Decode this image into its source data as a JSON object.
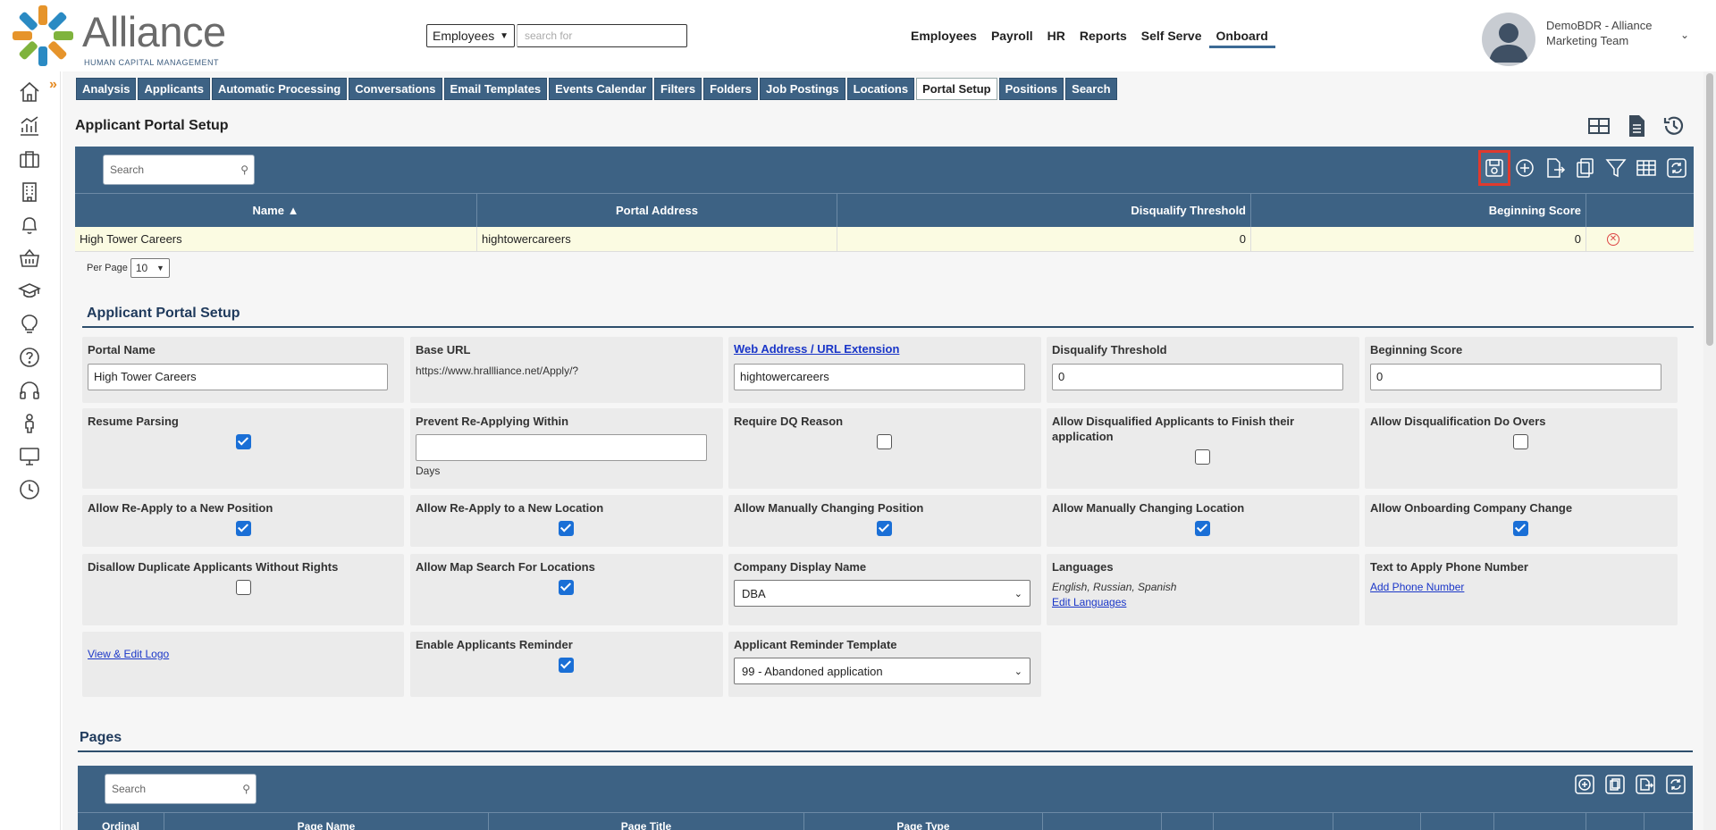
{
  "header": {
    "logo_word": "Alliance",
    "logo_sub": "HUMAN CAPITAL MANAGEMENT",
    "search_scope": "Employees",
    "search_placeholder": "search for",
    "nav": [
      "Employees",
      "Payroll",
      "HR",
      "Reports",
      "Self Serve",
      "Onboard"
    ],
    "active_nav": "Onboard",
    "user_line1": "DemoBDR - Alliance",
    "user_line2": "Marketing Team"
  },
  "rail": {
    "icons": [
      "home-icon",
      "analytics-icon",
      "briefcase-icon",
      "building-icon",
      "bell-icon",
      "basket-icon",
      "graduation-cap-icon",
      "lightbulb-icon",
      "help-icon",
      "headset-icon",
      "person-icon",
      "monitor-icon",
      "clock-icon"
    ]
  },
  "subnav": {
    "tabs": [
      "Analysis",
      "Applicants",
      "Automatic Processing",
      "Conversations",
      "Email Templates",
      "Events Calendar",
      "Filters",
      "Folders",
      "Job Postings",
      "Locations",
      "Portal Setup",
      "Positions",
      "Search"
    ],
    "active": "Portal Setup"
  },
  "page_title": "Applicant Portal Setup",
  "grid": {
    "search_placeholder": "Search",
    "columns": [
      "Name ▲",
      "Portal Address",
      "Disqualify Threshold",
      "Beginning Score"
    ],
    "rows": [
      {
        "name": "High Tower Careers",
        "address": "hightowercareers",
        "threshold": "0",
        "score": "0"
      }
    ],
    "per_page_label": "Per Page",
    "per_page_value": "10"
  },
  "form": {
    "section_title": "Applicant Portal Setup",
    "portal_name": {
      "label": "Portal Name",
      "value": "High Tower Careers"
    },
    "base_url": {
      "label": "Base URL",
      "value": "https://www.hrallliance.net/Apply/?"
    },
    "web_address": {
      "label": "Web Address / URL Extension",
      "value": "hightowercareers"
    },
    "disqualify_threshold": {
      "label": "Disqualify Threshold",
      "value": "0"
    },
    "beginning_score": {
      "label": "Beginning Score",
      "value": "0"
    },
    "resume_parsing": {
      "label": "Resume Parsing",
      "checked": true
    },
    "prevent_reapply": {
      "label": "Prevent Re-Applying Within",
      "value": "",
      "unit": "Days"
    },
    "require_dq": {
      "label": "Require DQ Reason",
      "checked": false
    },
    "allow_dq_finish": {
      "label": "Allow Disqualified Applicants to Finish their application",
      "checked": false
    },
    "allow_dq_doovers": {
      "label": "Allow Disqualification Do Overs",
      "checked": false
    },
    "reapply_position": {
      "label": "Allow Re-Apply to a New Position",
      "checked": true
    },
    "reapply_location": {
      "label": "Allow Re-Apply to a New Location",
      "checked": true
    },
    "manual_position": {
      "label": "Allow Manually Changing Position",
      "checked": true
    },
    "manual_location": {
      "label": "Allow Manually Changing Location",
      "checked": true
    },
    "onboarding_company": {
      "label": "Allow Onboarding Company Change",
      "checked": true
    },
    "disallow_duplicate": {
      "label": "Disallow Duplicate Applicants Without Rights",
      "checked": false
    },
    "map_search": {
      "label": "Allow Map Search For Locations",
      "checked": true
    },
    "company_display": {
      "label": "Company Display Name",
      "value": "DBA"
    },
    "languages": {
      "label": "Languages",
      "value": "English, Russian, Spanish",
      "link": "Edit Languages"
    },
    "text_to_apply": {
      "label": "Text to Apply Phone Number",
      "link": "Add Phone Number"
    },
    "logo_link": "View & Edit Logo",
    "enable_reminder": {
      "label": "Enable Applicants Reminder",
      "checked": true
    },
    "reminder_template": {
      "label": "Applicant Reminder Template",
      "value": "99 - Abandoned application"
    }
  },
  "pages": {
    "section_title": "Pages",
    "search_placeholder": "Search",
    "columns": [
      "Ordinal",
      "Page Name",
      "Page Title",
      "Page Type",
      "",
      "",
      "",
      "",
      "",
      "",
      "",
      ""
    ]
  },
  "colors": {
    "accent": "#3d6284",
    "highlight": "#e03a2e",
    "checkbox": "#1a6fd6",
    "row_highlight": "#fbfbe2"
  }
}
